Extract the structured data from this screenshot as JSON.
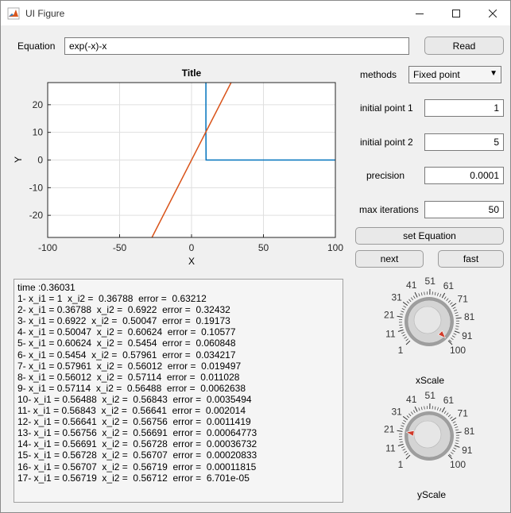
{
  "window": {
    "title": "UI Figure",
    "icon": "matlab-logo-icon"
  },
  "equation": {
    "label": "Equation",
    "value": "exp(-x)-x"
  },
  "read_button": "Read",
  "methods": {
    "label": "methods",
    "selected": "Fixed point"
  },
  "fields": {
    "initial_point_1": {
      "label": "initial point 1",
      "value": "1"
    },
    "initial_point_2": {
      "label": "initial point 2",
      "value": "5"
    },
    "precision": {
      "label": "precision",
      "value": "0.0001"
    },
    "max_iterations": {
      "label": "max iterations",
      "value": "50"
    }
  },
  "buttons": {
    "set_equation": "set Equation",
    "next": "next",
    "fast": "fast"
  },
  "chart_data": {
    "type": "line",
    "title": "Title",
    "xlabel": "X",
    "ylabel": "Y",
    "xlim": [
      -100,
      100
    ],
    "ylim": [
      -28,
      28
    ],
    "xticks": [
      "-100",
      "-50",
      "0",
      "50",
      "100"
    ],
    "yticks": [
      "20",
      "10",
      "0",
      "-10",
      "-20"
    ],
    "grid": true,
    "series": [
      {
        "color": "#0072bd",
        "x": [
          10,
          10,
          10.1,
          100
        ],
        "y": [
          28,
          10,
          0,
          0
        ]
      },
      {
        "color": "#d95319",
        "x": [
          -27.5,
          27.5
        ],
        "y": [
          -28,
          28
        ]
      }
    ]
  },
  "log": [
    "time :0.36031",
    "1- x_i1 = 1  x_i2 =  0.36788  error =  0.63212",
    "2- x_i1 = 0.36788  x_i2 =  0.6922  error =  0.32432",
    "3- x_i1 = 0.6922  x_i2 =  0.50047  error =  0.19173",
    "4- x_i1 = 0.50047  x_i2 =  0.60624  error =  0.10577",
    "5- x_i1 = 0.60624  x_i2 =  0.5454  error =  0.060848",
    "6- x_i1 = 0.5454  x_i2 =  0.57961  error =  0.034217",
    "7- x_i1 = 0.57961  x_i2 =  0.56012  error =  0.019497",
    "8- x_i1 = 0.56012  x_i2 =  0.57114  error =  0.011028",
    "9- x_i1 = 0.57114  x_i2 =  0.56488  error =  0.0062638",
    "10- x_i1 = 0.56488  x_i2 =  0.56843  error =  0.0035494",
    "11- x_i1 = 0.56843  x_i2 =  0.56641  error =  0.002014",
    "12- x_i1 = 0.56641  x_i2 =  0.56756  error =  0.0011419",
    "13- x_i1 = 0.56756  x_i2 =  0.56691  error =  0.00064773",
    "14- x_i1 = 0.56691  x_i2 =  0.56728  error =  0.00036732",
    "15- x_i1 = 0.56728  x_i2 =  0.56707  error =  0.00020833",
    "16- x_i1 = 0.56707  x_i2 =  0.56719  error =  0.00011815",
    "17- x_i1 = 0.56719  x_i2 =  0.56712  error =  6.701e-05"
  ],
  "knobs": [
    {
      "label": "xScale",
      "value": 100,
      "ticks": [
        "1",
        "11",
        "21",
        "31",
        "41",
        "51",
        "61",
        "71",
        "81",
        "91",
        "100"
      ]
    },
    {
      "label": "yScale",
      "value": 21,
      "ticks": [
        "1",
        "11",
        "21",
        "31",
        "41",
        "51",
        "61",
        "71",
        "81",
        "91",
        "100"
      ]
    }
  ]
}
